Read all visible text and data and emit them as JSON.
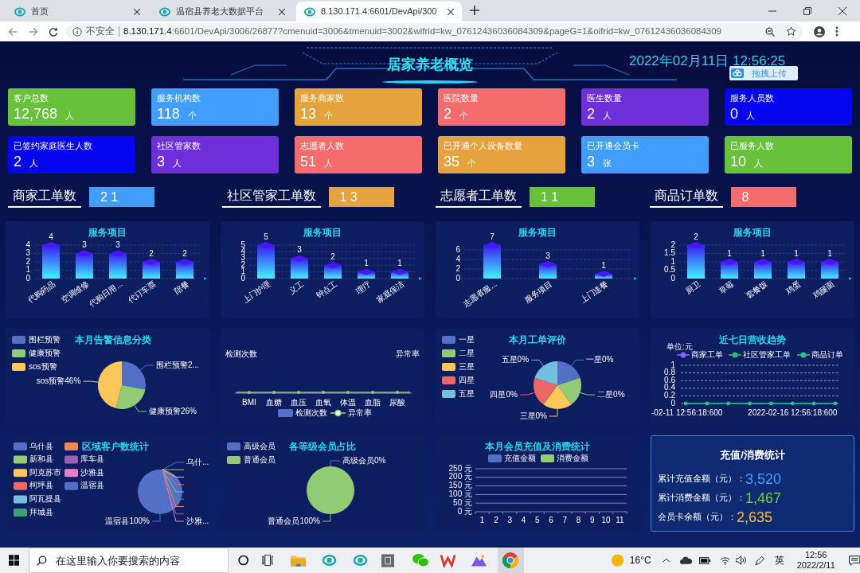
{
  "browser": {
    "tabs": [
      {
        "label": "首页",
        "selected": false
      },
      {
        "label": "温宿县养老大数据平台",
        "selected": false
      },
      {
        "label": "8.130.171.4:6601/DevApi/300",
        "selected": true
      }
    ],
    "address_bar": {
      "security": "不安全",
      "url": "**8.130.171.4**:6601/DevApi/3006/26877?cmenuid=3006&tmenuid=3002&wifrid=kw_07612436036084309&pageG=1&oifrid=kw_07612436036084309"
    }
  },
  "header": {
    "title": "居家养老概览",
    "datetime": "2022年02月11日 12:56:25",
    "upload_button": "拖拽上传"
  },
  "stats": [
    {
      "label": "客户总数",
      "value": "12,768",
      "unit": "人",
      "color": "#67c23a"
    },
    {
      "label": "服务机构数",
      "value": "118",
      "unit": "个",
      "color": "#409eff"
    },
    {
      "label": "服务商家数",
      "value": "13",
      "unit": "个",
      "color": "#e6a23c"
    },
    {
      "label": "医院数量",
      "value": "2",
      "unit": "个",
      "color": "#f56c6c"
    },
    {
      "label": "医生数量",
      "value": "2",
      "unit": "人",
      "color": "#6d2fd9"
    },
    {
      "label": "服务人员数",
      "value": "0",
      "unit": "人",
      "color": "#0505f0"
    },
    {
      "label": "已签约家庭医生人数",
      "value": "2",
      "unit": "人",
      "color": "#0505f0"
    },
    {
      "label": "社区管家数",
      "value": "3",
      "unit": "人",
      "color": "#6d2fd9"
    },
    {
      "label": "志愿者人数",
      "value": "51",
      "unit": "人",
      "color": "#f56c6c"
    },
    {
      "label": "已开通个人设备数量",
      "value": "35",
      "unit": "个",
      "color": "#e6a23c"
    },
    {
      "label": "已开通会员卡",
      "value": "3",
      "unit": "张",
      "color": "#409eff"
    },
    {
      "label": "已服务人数",
      "value": "10",
      "unit": "人",
      "color": "#67c23a"
    }
  ],
  "order_counts": [
    {
      "label": "商家工单数",
      "value": "2 1",
      "color": "#409eff"
    },
    {
      "label": "社区管家工单数",
      "value": "1 3",
      "color": "#e6a23c"
    },
    {
      "label": "志愿者工单数",
      "value": "1 1",
      "color": "#67c23a"
    },
    {
      "label": "商品订单数",
      "value": "8",
      "color": "#f56c6c"
    }
  ],
  "service_charts": [
    {
      "chart_data": {
        "type": "bar",
        "title": "服务项目",
        "categories": [
          "代购药品",
          "空调维修",
          "代购日用...",
          "代订车票",
          "陪餐"
        ],
        "values": [
          4,
          3,
          3,
          2,
          2
        ],
        "ylim": [
          0,
          4
        ],
        "yticks": [
          0,
          1,
          2,
          3,
          4
        ],
        "grid": true,
        "data_labels": true
      }
    },
    {
      "chart_data": {
        "type": "bar",
        "title": "服务项目",
        "categories": [
          "上门护理",
          "义工",
          "钟点工",
          "理疗",
          "家庭保洁"
        ],
        "values": [
          5,
          3,
          2,
          1,
          1
        ],
        "ylim": [
          0,
          5
        ],
        "yticks": [
          0,
          1,
          2,
          3,
          4,
          5
        ],
        "grid": true,
        "data_labels": true
      }
    },
    {
      "chart_data": {
        "type": "bar",
        "title": "服务项目",
        "categories": [
          "志愿者服...",
          "服务项目",
          "上门送餐"
        ],
        "values": [
          7,
          3,
          1
        ],
        "ylim": [
          0,
          7
        ],
        "yticks": [
          0,
          2,
          4,
          6
        ],
        "grid": true,
        "data_labels": true
      }
    },
    {
      "chart_data": {
        "type": "bar",
        "title": "服务项目",
        "categories": [
          "厨卫",
          "草莓",
          "套餐饭",
          "鸡蛋",
          "鸡腿面"
        ],
        "values": [
          2,
          1,
          1,
          1,
          1
        ],
        "ylim": [
          0,
          2
        ],
        "yticks": [
          0,
          0.5,
          1,
          1.5,
          2
        ],
        "grid": true,
        "data_labels": true
      }
    }
  ],
  "alert_chart": {
    "legend": [
      {
        "color": "#5470c6"
      },
      {
        "color": "#91cc75"
      },
      {
        "color": "#fac858"
      }
    ],
    "chart_data": {
      "type": "pie",
      "title": "本月告警信息分类",
      "legend": "left",
      "categories": [
        "围栏预警",
        "健康预警",
        "sos预警"
      ],
      "values": [
        28,
        26,
        46
      ],
      "value_labels": [
        "围栏预警2...",
        "健康预警26%",
        "sos预警46%"
      ]
    }
  },
  "health_chart": {
    "left_axis_label": "检测次数",
    "right_axis_label": "异常率",
    "categories": [
      "BMI",
      "血糖",
      "血压",
      "血氧",
      "体温",
      "血脂",
      "尿酸"
    ],
    "legend": [
      {
        "label": "检测次数",
        "kind": "bar",
        "color": "#5470c6"
      },
      {
        "label": "异常率",
        "kind": "line",
        "color": "#91cc75"
      }
    ]
  },
  "rating_chart": {
    "legend": [
      {
        "color": "#5470c6"
      },
      {
        "color": "#91cc75"
      },
      {
        "color": "#fac858"
      },
      {
        "color": "#ee6666"
      },
      {
        "color": "#73c0de"
      }
    ],
    "chart_data": {
      "type": "pie",
      "title": "本月工单评价",
      "legend": "left",
      "categories": [
        "一星",
        "二星",
        "三星",
        "四星",
        "五星"
      ],
      "values": [
        20,
        20,
        20,
        20,
        20
      ],
      "value_labels": [
        "一星0%",
        "二星0%",
        "三星0%",
        "四星0%",
        "五星0%"
      ]
    }
  },
  "revenue_chart": {
    "unit": "单位:元",
    "chart_data": {
      "type": "line",
      "title": "近七日营收趋势",
      "legend": "top",
      "categories": [
        "-02-11 12:56:18:600",
        null,
        null,
        null,
        null,
        "2022-02-16 12:56:18:600",
        null,
        null
      ],
      "ylim": [
        0,
        1
      ],
      "yticks": [
        0,
        0.2,
        0.4,
        0.6,
        0.8,
        1
      ],
      "grid": true,
      "series": [
        {
          "name": "商家工单",
          "color": "#8c5cff",
          "values": [
            null,
            null,
            null,
            null,
            null,
            null,
            null,
            null
          ]
        },
        {
          "name": "社区管家工单",
          "color": "#1ec46a",
          "values": [
            null,
            null,
            null,
            null,
            null,
            null,
            null,
            null
          ]
        },
        {
          "name": "商品订单",
          "color": "#19c98a",
          "values": [
            0,
            0,
            0,
            0,
            0,
            0,
            0,
            0
          ]
        }
      ]
    }
  },
  "region_chart": {
    "legend": [
      {
        "color": "#5470c6"
      },
      {
        "color": "#91cc75"
      },
      {
        "color": "#fac858"
      },
      {
        "color": "#ee6666"
      },
      {
        "color": "#73c0de"
      },
      {
        "color": "#3ba272"
      },
      {
        "color": "#fc8452"
      },
      {
        "color": "#9a60b4"
      },
      {
        "color": "#ea7ccc"
      },
      {
        "color": "#5470c6"
      }
    ],
    "chart_data": {
      "type": "pie",
      "title": "区域客户数统计",
      "legend": "left",
      "categories": [
        "乌什县",
        "新和县",
        "阿克苏市",
        "柯坪县",
        "阿瓦提县",
        "拜城县",
        null,
        "库车县",
        "沙雅县",
        "温宿县"
      ],
      "values": [
        0,
        0,
        0,
        0,
        0,
        0,
        0,
        0,
        0,
        100
      ],
      "value_labels": [
        "乌什...",
        null,
        null,
        null,
        null,
        null,
        null,
        null,
        "沙雅...",
        "温宿县100%"
      ]
    }
  },
  "member_chart": {
    "legend": [
      {
        "color": "#5470c6"
      },
      {
        "color": "#91cc75"
      }
    ],
    "chart_data": {
      "type": "pie",
      "title": "各等级会员占比",
      "legend": "left",
      "categories": [
        "高级会员",
        "普通会员"
      ],
      "values": [
        0,
        100
      ],
      "value_labels": [
        "高级会员0%",
        "普通会员100%"
      ]
    }
  },
  "recharge_chart": {
    "chart_data": {
      "type": "bar",
      "title": "本月会员充值及消费统计",
      "legend": "top",
      "categories": [
        "1",
        "2",
        "3",
        "4",
        "5",
        "6",
        "7",
        "8",
        "9",
        "10",
        "11"
      ],
      "ylim": [
        0,
        250
      ],
      "grid": true,
      "yticks": [
        {
          "value": 0,
          "label": "0 元"
        },
        {
          "value": 50,
          "label": "50 元"
        },
        {
          "value": 100,
          "label": "100 元"
        },
        {
          "value": 150,
          "label": "150 元"
        },
        {
          "value": 200,
          "label": "200 元"
        },
        {
          "value": 250,
          "label": "250 元"
        }
      ],
      "series": [
        {
          "name": "充值金额",
          "color": "#5470c6",
          "values": [
            0,
            0,
            0,
            0,
            0,
            0,
            0,
            0,
            0,
            0,
            0
          ]
        },
        {
          "name": "消费金额",
          "color": "#91cc75",
          "values": [
            0,
            0,
            0,
            0,
            0,
            0,
            0,
            0,
            0,
            0,
            0
          ]
        }
      ]
    }
  },
  "summary": {
    "title": "充值/消费统计",
    "rows": [
      {
        "label": "累计充值金额（元）：",
        "value": "3,520",
        "color": "#3ba0ff"
      },
      {
        "label": "累计消费金额（元）：",
        "value": "1,467",
        "color": "#6cd23a"
      },
      {
        "label": "会员卡余额（元）：",
        "value": "2,635",
        "color": "#ffc21a"
      }
    ]
  },
  "taskbar": {
    "search_placeholder": "在这里输入你要搜索的内容",
    "temperature": "16°C",
    "language": "英",
    "time": "12:56",
    "date": "2022/2/11"
  }
}
